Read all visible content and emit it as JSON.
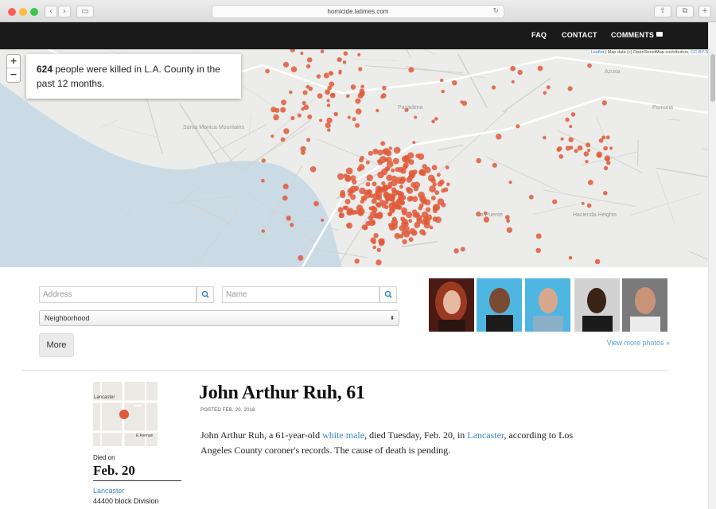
{
  "browser": {
    "url": "homicide.latimes.com",
    "back_icon": "chevron-left-icon",
    "forward_icon": "chevron-right-icon"
  },
  "header": {
    "nav": [
      {
        "label": "FAQ"
      },
      {
        "label": "CONTACT"
      },
      {
        "label": "COMMENTS"
      }
    ]
  },
  "map": {
    "zoom_in": "+",
    "zoom_out": "−",
    "callout_count": "624",
    "callout_text": " people were killed in L.A. County in the past 12 months.",
    "attribution_leaflet": "Leaflet",
    "attribution_text": " | Map data (c) OpenStreetMap contributors, ",
    "attribution_license": "CC-BY-SA",
    "marker_color": "#e05a3a",
    "water_color": "#cbdbe6",
    "labels": [
      "Santa Monica Mountains",
      "Pasadena",
      "Pomona",
      "Hacienda Heights",
      "La Puente",
      "Azusa"
    ]
  },
  "filters": {
    "address_placeholder": "Address",
    "name_placeholder": "Name",
    "neighborhood_label": "Neighborhood",
    "more_label": "More",
    "view_more": "View more photos »"
  },
  "victim": {
    "name_age": "John Arthur Ruh, 61",
    "posted": "POSTED FEB. 20, 2018",
    "died_label": "Died on",
    "died_date": "Feb. 20",
    "place": "Lancaster",
    "address": "44400 block Division",
    "minimap_labels": [
      "Lancaster",
      "E Avenue"
    ],
    "story": {
      "p1": "John Arthur Ruh, a 61-year-old ",
      "link1": "white male",
      "p2": ", died Tuesday, Feb. 20, in ",
      "link2": "Lancaster",
      "p3": ", according to Los Angeles County coroner's records. The cause of death is pending."
    }
  }
}
